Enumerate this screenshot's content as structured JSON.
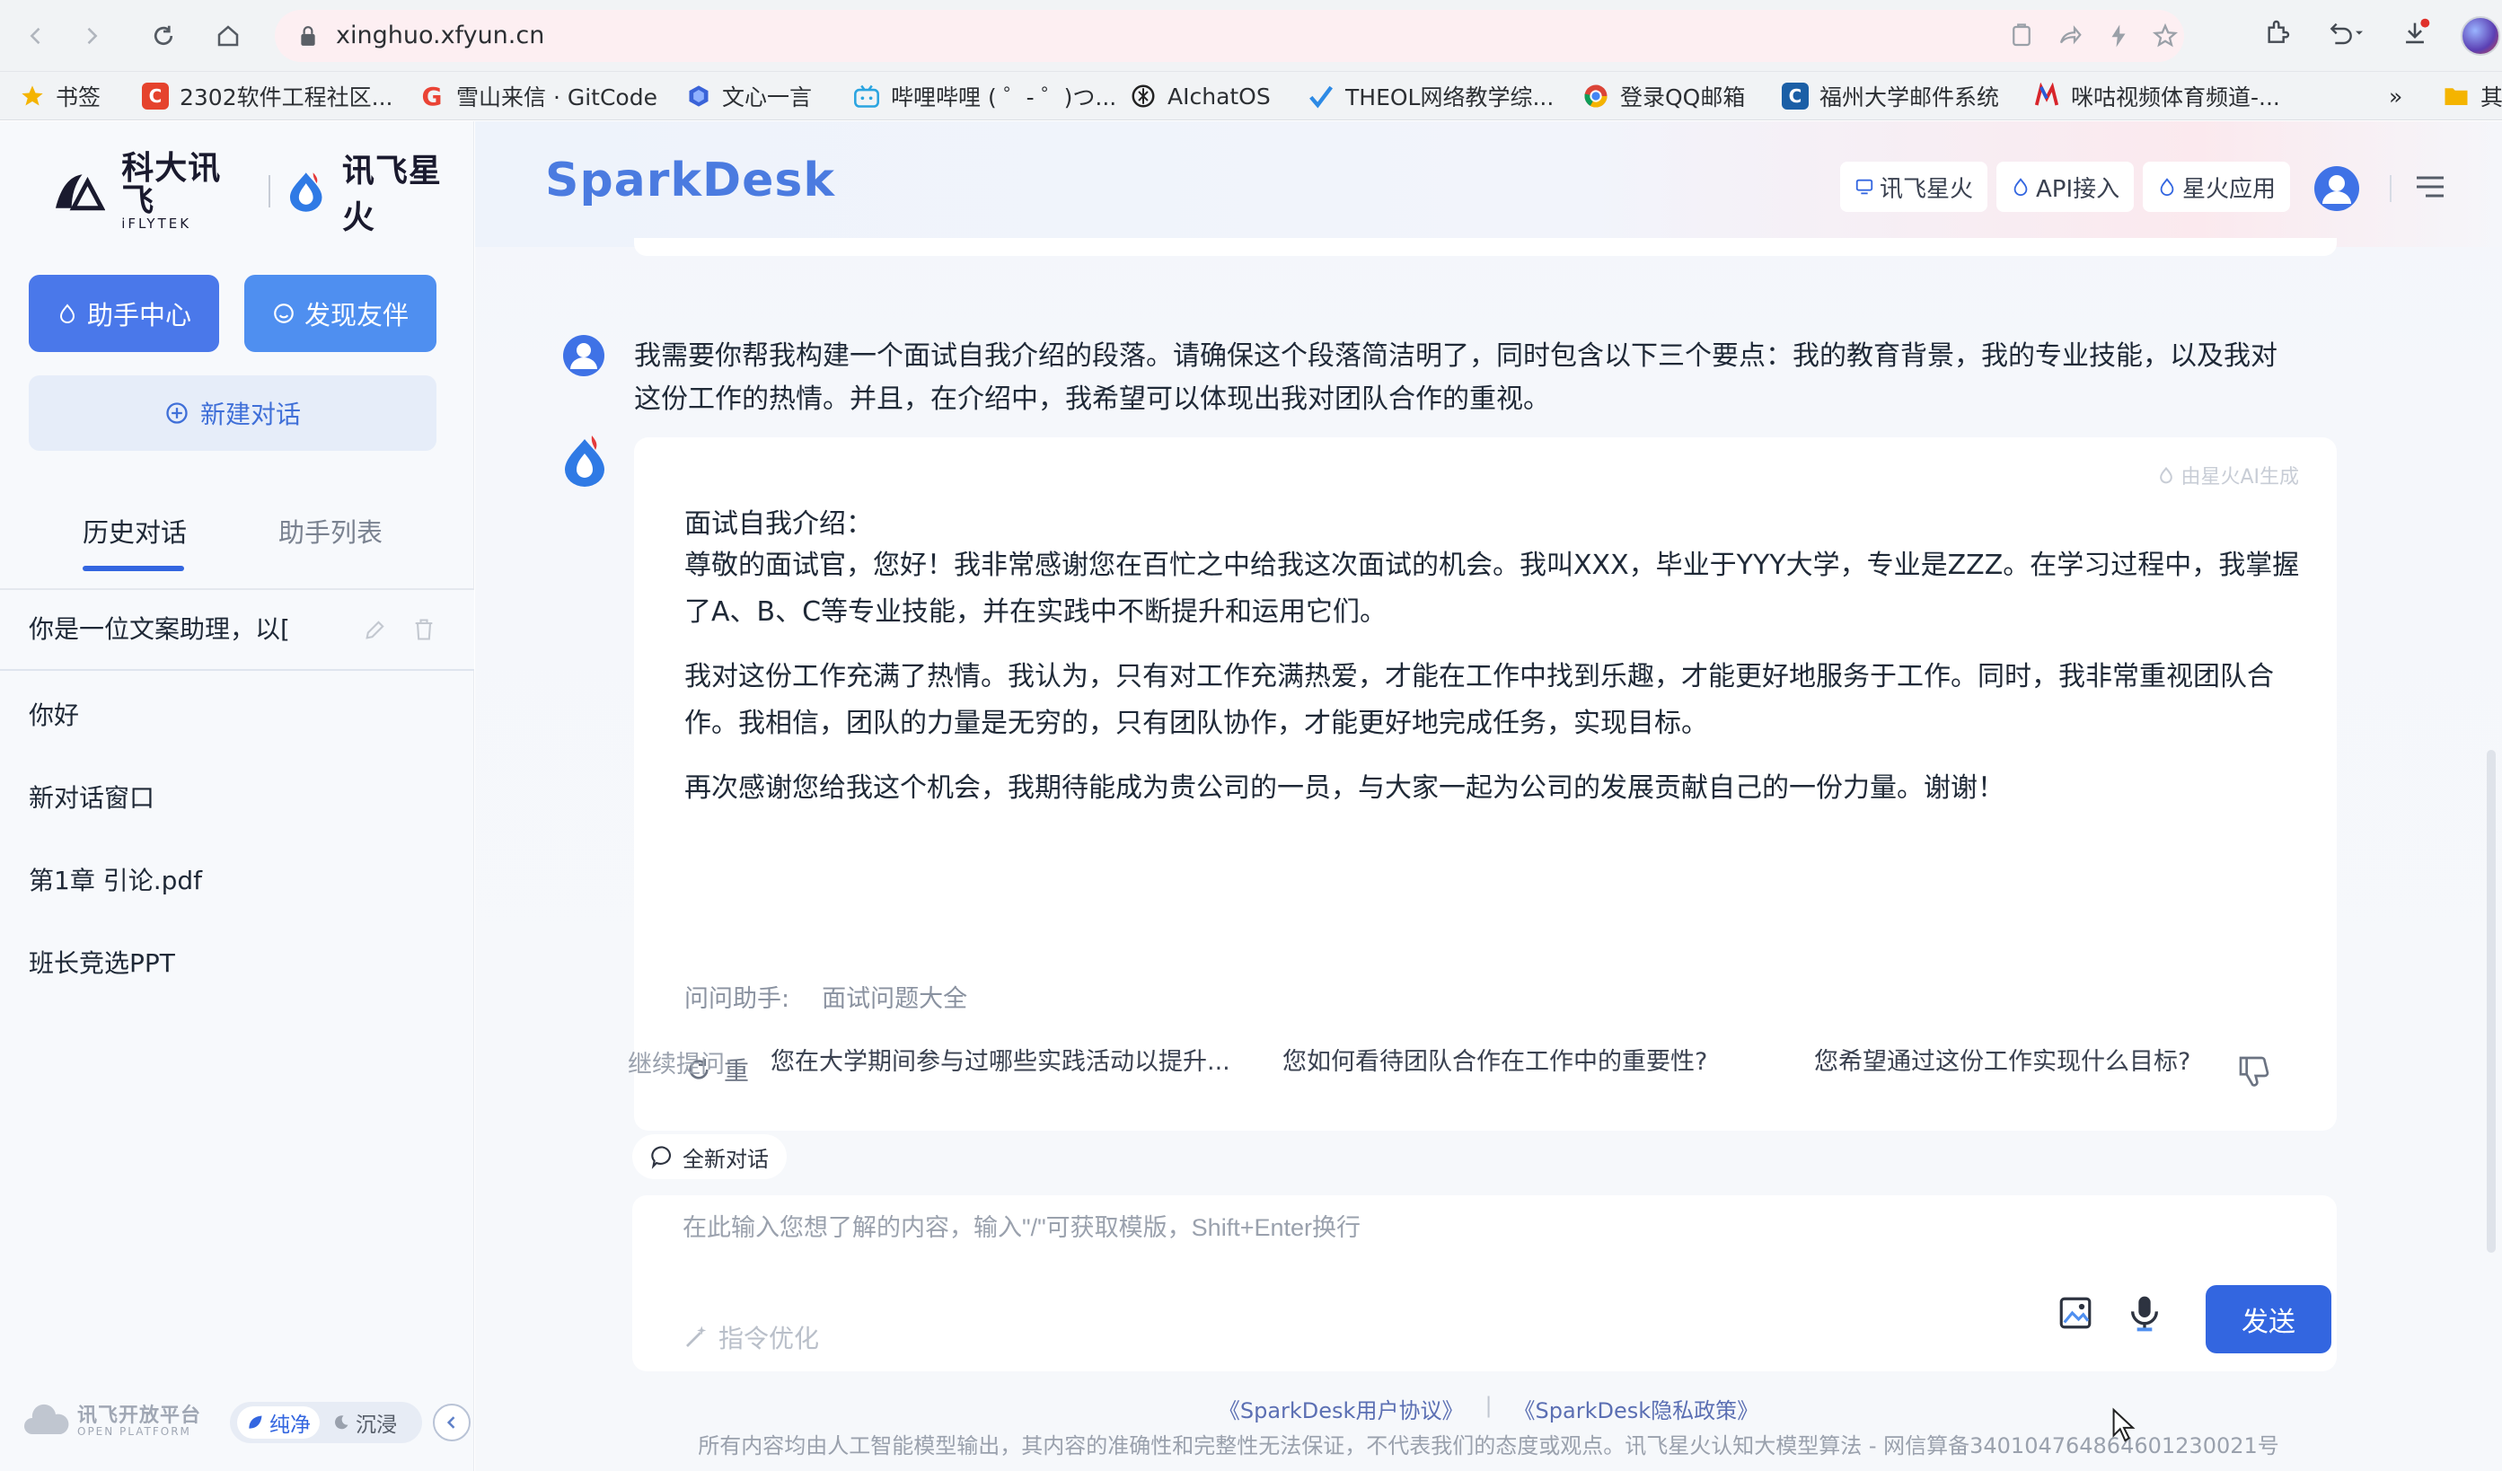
{
  "browser": {
    "url": "xinghuo.xfyun.cn",
    "bookmarks": [
      {
        "label": "书签",
        "icon": "star-icon"
      },
      {
        "label": "2302软件工程社区...",
        "icon": "csdn-icon"
      },
      {
        "label": "雪山来信 · GitCode",
        "icon": "google-icon"
      },
      {
        "label": "文心一言",
        "icon": "wenxin-icon"
      },
      {
        "label": "哔哩哔哩 ( ゜- ゜)つ...",
        "icon": "bilibili-icon"
      },
      {
        "label": "AIchatOS",
        "icon": "openai-icon"
      },
      {
        "label": "THEOL网络教学综...",
        "icon": "theol-icon"
      },
      {
        "label": "登录QQ邮箱",
        "icon": "chrome-icon"
      },
      {
        "label": "福州大学邮件系统",
        "icon": "mail-icon"
      },
      {
        "label": "咪咕视频体育频道-...",
        "icon": "migu-icon"
      }
    ],
    "overflow": "»",
    "other_bookmarks": "其"
  },
  "sidebar": {
    "logo_primary": "科大讯飞",
    "logo_primary_sub": "iFLYTEK",
    "logo_secondary": "讯飞星火",
    "assistant_center": "助手中心",
    "discover_partner": "发现友伴",
    "new_chat": "新建对话",
    "tabs": [
      "历史对话",
      "助手列表"
    ],
    "history": [
      "你是一位文案助理，以[",
      "你好",
      "新对话窗口",
      "第1章 引论.pdf",
      "班长竞选PPT"
    ],
    "footer": {
      "platform": "讯飞开放平台",
      "platform_sub": "OPEN PLATFORM",
      "mode_pure": "纯净",
      "mode_immerse": "沉浸"
    }
  },
  "header": {
    "brand": "SparkDesk",
    "links": [
      "讯飞星火",
      "API接入",
      "星火应用"
    ]
  },
  "chat": {
    "user_message": "我需要你帮我构建一个面试自我介绍的段落。请确保这个段落简洁明了，同时包含以下三个要点：我的教育背景，我的专业技能，以及我对这份工作的热情。并且，在介绍中，我希望可以体现出我对团队合作的重视。",
    "ai_badge": "由星火AI生成",
    "answer": {
      "heading": "面试自我介绍：",
      "paragraphs": [
        "尊敬的面试官，您好！我非常感谢您在百忙之中给我这次面试的机会。我叫XXX，毕业于YYY大学，专业是ZZZ。在学习过程中，我掌握了A、B、C等专业技能，并在实践中不断提升和运用它们。",
        "我对这份工作充满了热情。我认为，只有对工作充满热爱，才能在工作中找到乐趣，才能更好地服务于工作。同时，我非常重视团队合作。我相信，团队的力量是无穷的，只有团队协作，才能更好地完成任务，实现目标。",
        "再次感谢您给我这个机会，我期待能成为贵公司的一员，与大家一起为公司的发展贡献自己的一份力量。谢谢！"
      ]
    },
    "ask_assistant_label": "问问助手:",
    "ask_assistant_link": "面试问题大全",
    "regenerate": "重新回答",
    "suggest_label": "继续提问:",
    "suggestions": [
      "您在大学期间参与过哪些实践活动以提升...",
      "您如何看待团队合作在工作中的重要性?",
      "您希望通过这份工作实现什么目标?"
    ]
  },
  "composer": {
    "new_topic": "全新对话",
    "placeholder": "在此输入您想了解的内容，输入\"/\"可获取模版，Shift+Enter换行",
    "prompt_optimize": "指令优化",
    "send": "发送"
  },
  "footer": {
    "user_agreement": "《SparkDesk用户协议》",
    "sep": "|",
    "privacy": "《SparkDesk隐私政策》",
    "disclaimer": "所有内容均由人工智能模型输出，其内容的准确性和完整性无法保证，不代表我们的态度或观点。讯飞星火认知大模型算法 - 网信算备340104764864601230021号"
  },
  "colors": {
    "accent": "#3366e0",
    "accent_light": "#4f8ff0",
    "sidebar_bg": "#f7f9fc",
    "main_bg": "#f5f7fb"
  }
}
